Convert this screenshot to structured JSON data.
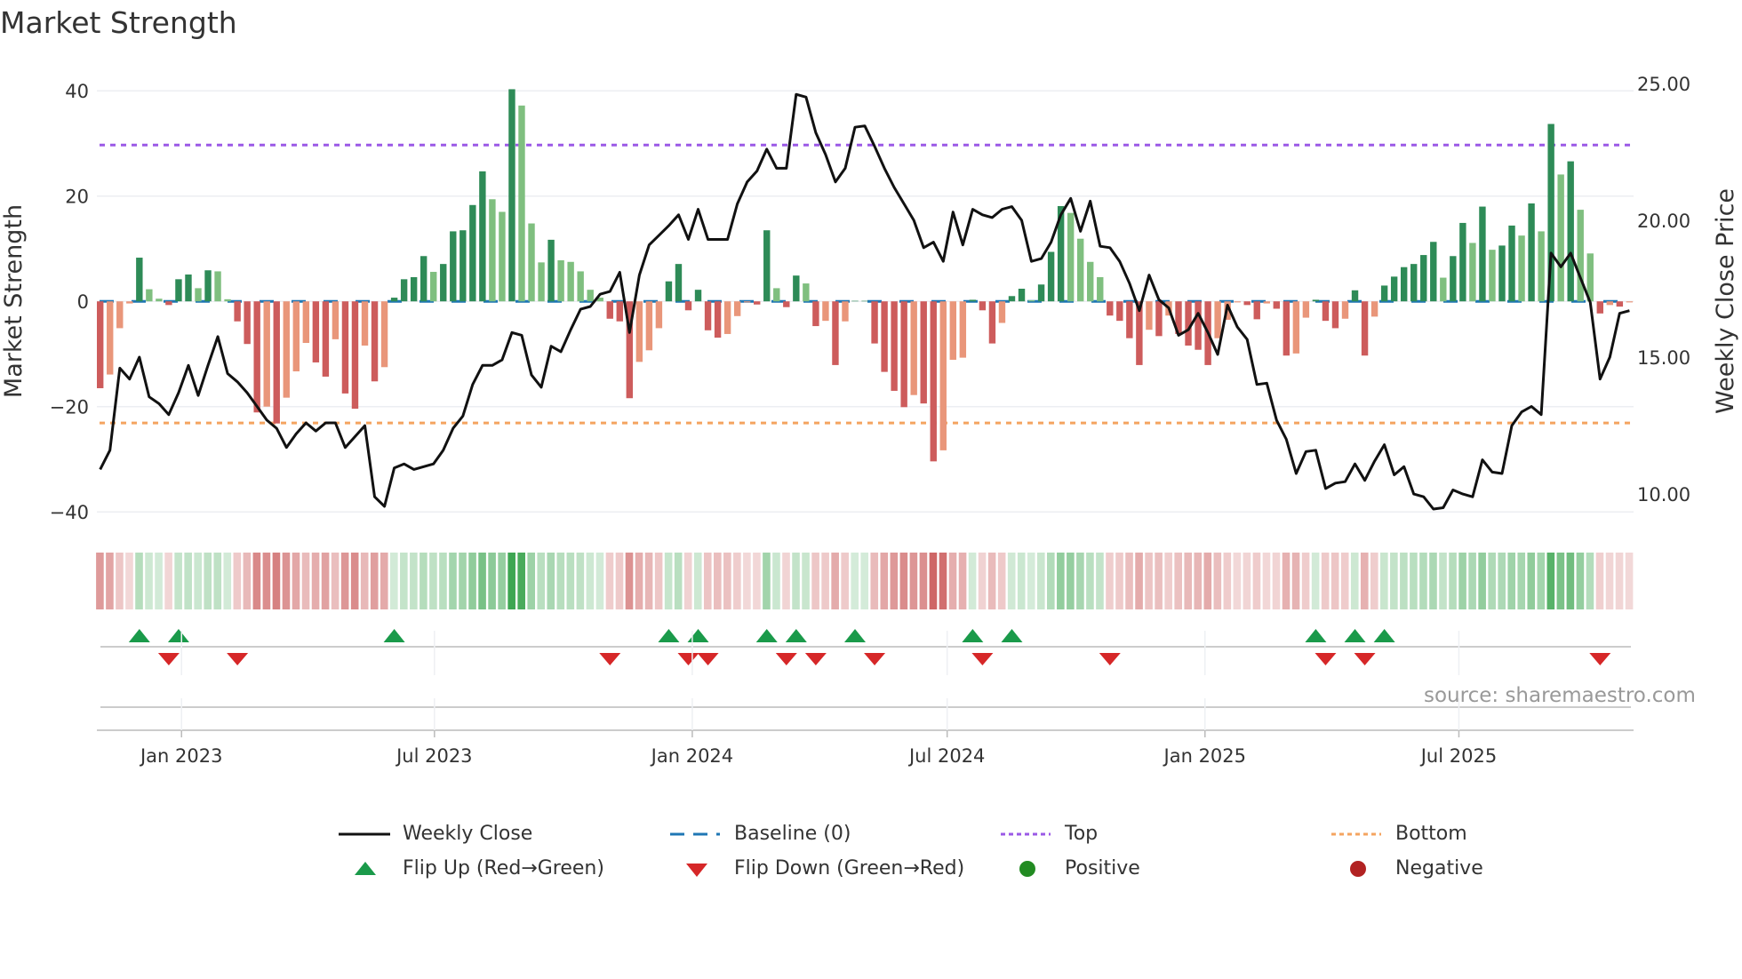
{
  "title": "Market Strength",
  "source": "source: sharemaestro.com",
  "colors": {
    "pos_strong": "#2e8b57",
    "pos_weak": "#7fbf7f",
    "neg_strong": "#cd5c5c",
    "neg_weak": "#e9967a",
    "baseline": "#1f77b4",
    "top": "#9b59e6",
    "bottom": "#f4a460",
    "flip_up": "#1a9a4a",
    "flip_down": "#d62728",
    "positive": "#228b22",
    "negative": "#b22222",
    "line": "#111111"
  },
  "legend": [
    {
      "key": "weekly_close",
      "label": "Weekly Close"
    },
    {
      "key": "baseline",
      "label": "Baseline (0)"
    },
    {
      "key": "top",
      "label": "Top"
    },
    {
      "key": "bottom",
      "label": "Bottom"
    },
    {
      "key": "flip_up",
      "label": "Flip Up (Red→Green)"
    },
    {
      "key": "flip_down",
      "label": "Flip Down (Green→Red)"
    },
    {
      "key": "positive",
      "label": "Positive"
    },
    {
      "key": "negative",
      "label": "Negative"
    }
  ],
  "chart_data": {
    "type": "bar",
    "title": "Market Strength",
    "ylabel": "Market Strength",
    "y2label": "Weekly Close Price",
    "ylim": [
      -43,
      44
    ],
    "y2lim": [
      8.77,
      25.5
    ],
    "yticks": [
      {
        "v": 40,
        "label": "40"
      },
      {
        "v": 20,
        "label": "20"
      },
      {
        "v": 0,
        "label": "0"
      },
      {
        "v": -20,
        "label": "−20"
      },
      {
        "v": -40,
        "label": "−40"
      }
    ],
    "y2ticks": [
      {
        "v": 25,
        "label": "25.00"
      },
      {
        "v": 20,
        "label": "20.00"
      },
      {
        "v": 15,
        "label": "15.00"
      },
      {
        "v": 10,
        "label": "10.00"
      }
    ],
    "xticks": [
      {
        "week": 8.3,
        "label": "Jan 2023"
      },
      {
        "week": 34.1,
        "label": "Jul 2023"
      },
      {
        "week": 60.4,
        "label": "Jan 2024"
      },
      {
        "week": 86.4,
        "label": "Jul 2024"
      },
      {
        "week": 112.7,
        "label": "Jan 2025"
      },
      {
        "week": 138.6,
        "label": "Jul 2025"
      }
    ],
    "top_level": 29.7,
    "bottom_level": -23.1,
    "baseline": 0,
    "strength": [
      -16.5,
      -13.9,
      -5.1,
      -0.4,
      8.3,
      2.3,
      0.5,
      -0.7,
      4.2,
      5.1,
      2.5,
      5.9,
      5.7,
      0.4,
      -3.8,
      -8.1,
      -21.1,
      -20,
      -23.2,
      -18.3,
      -13.3,
      -7.9,
      -11.6,
      -14.3,
      -7.2,
      -17.5,
      -20.4,
      -8.4,
      -15.2,
      -12.5,
      0.7,
      4.2,
      4.6,
      8.6,
      5.6,
      7.1,
      13.3,
      13.5,
      18.3,
      24.7,
      19.4,
      17.0,
      40.3,
      37.2,
      14.8,
      7.4,
      11.7,
      7.8,
      7.5,
      5.7,
      2.2,
      0.7,
      -3.3,
      -3.8,
      -18.4,
      -11.5,
      -9.3,
      -5.1,
      3.8,
      7.1,
      -1.7,
      2.2,
      -5.5,
      -6.9,
      -6.2,
      -2.8,
      -0.2,
      -0.6,
      13.5,
      2.5,
      -1.1,
      4.9,
      3.4,
      -4.7,
      -3.7,
      -12.1,
      -3.8,
      0.1,
      0.1,
      -8.0,
      -13.4,
      -17.0,
      -20.1,
      -17.8,
      -19.4,
      -30.4,
      -28.3,
      -11.1,
      -10.7,
      0.3,
      -1.7,
      -8.0,
      -4.1,
      1.0,
      2.4,
      0.2,
      3.2,
      9.4,
      18.1,
      16.8,
      11.9,
      7.5,
      4.6,
      -2.7,
      -3.7,
      -7.0,
      -12.1,
      -5.4,
      -6.6,
      -2.7,
      -6.2,
      -8.4,
      -9.2,
      -12.1,
      -7.0,
      -3.5,
      -0.2,
      -0.7,
      -3.4,
      -0.4,
      -1.4,
      -10.3,
      -9.9,
      -3.1,
      0.3,
      -3.7,
      -5.1,
      -3.3,
      2.1,
      -10.3,
      -2.9,
      3.0,
      4.7,
      6.5,
      7.1,
      8.8,
      11.3,
      4.5,
      8.6,
      14.9,
      11.1,
      18.0,
      9.8,
      10.6,
      14.4,
      12.5,
      18.6,
      13.3,
      33.7,
      24.1,
      26.6,
      17.4,
      9.1,
      -2.3,
      -0.7,
      -1.0,
      -0.2
    ],
    "weekly_close": [
      10.9,
      11.6,
      14.6,
      14.2,
      15.0,
      13.55,
      13.3,
      12.9,
      13.7,
      14.7,
      13.6,
      14.7,
      15.75,
      14.4,
      14.1,
      13.7,
      13.2,
      12.7,
      12.4,
      11.7,
      12.2,
      12.6,
      12.3,
      12.6,
      12.6,
      11.7,
      12.1,
      12.5,
      9.9,
      9.55,
      10.95,
      11.1,
      10.9,
      11.0,
      11.1,
      11.6,
      12.4,
      12.85,
      14.0,
      14.7,
      14.7,
      14.9,
      15.9,
      15.8,
      14.35,
      13.9,
      15.4,
      15.2,
      16.0,
      16.75,
      16.85,
      17.3,
      17.4,
      18.1,
      15.9,
      18.0,
      19.1,
      19.45,
      19.8,
      20.2,
      19.3,
      20.4,
      19.3,
      19.3,
      19.3,
      20.6,
      21.4,
      21.8,
      22.6,
      21.9,
      21.9,
      24.6,
      24.5,
      23.2,
      22.4,
      21.4,
      21.9,
      23.4,
      23.45,
      22.7,
      21.9,
      21.2,
      20.6,
      20.0,
      19.0,
      19.2,
      18.5,
      20.3,
      19.1,
      20.4,
      20.2,
      20.1,
      20.4,
      20.5,
      20.0,
      18.5,
      18.6,
      19.2,
      20.2,
      20.8,
      19.6,
      20.7,
      19.05,
      19.0,
      18.5,
      17.7,
      16.7,
      18.0,
      17.1,
      16.8,
      15.8,
      16.0,
      16.6,
      15.9,
      15.1,
      16.9,
      16.1,
      15.65,
      14.0,
      14.05,
      12.7,
      12.0,
      10.75,
      11.55,
      11.6,
      10.2,
      10.4,
      10.45,
      11.1,
      10.5,
      11.2,
      11.8,
      10.7,
      11.0,
      10.0,
      9.9,
      9.45,
      9.5,
      10.15,
      10.0,
      9.9,
      11.25,
      10.8,
      10.75,
      12.5,
      13.0,
      13.2,
      12.9,
      18.8,
      18.3,
      18.8,
      17.9,
      17.0,
      14.2,
      15.0,
      16.6,
      16.7
    ]
  }
}
